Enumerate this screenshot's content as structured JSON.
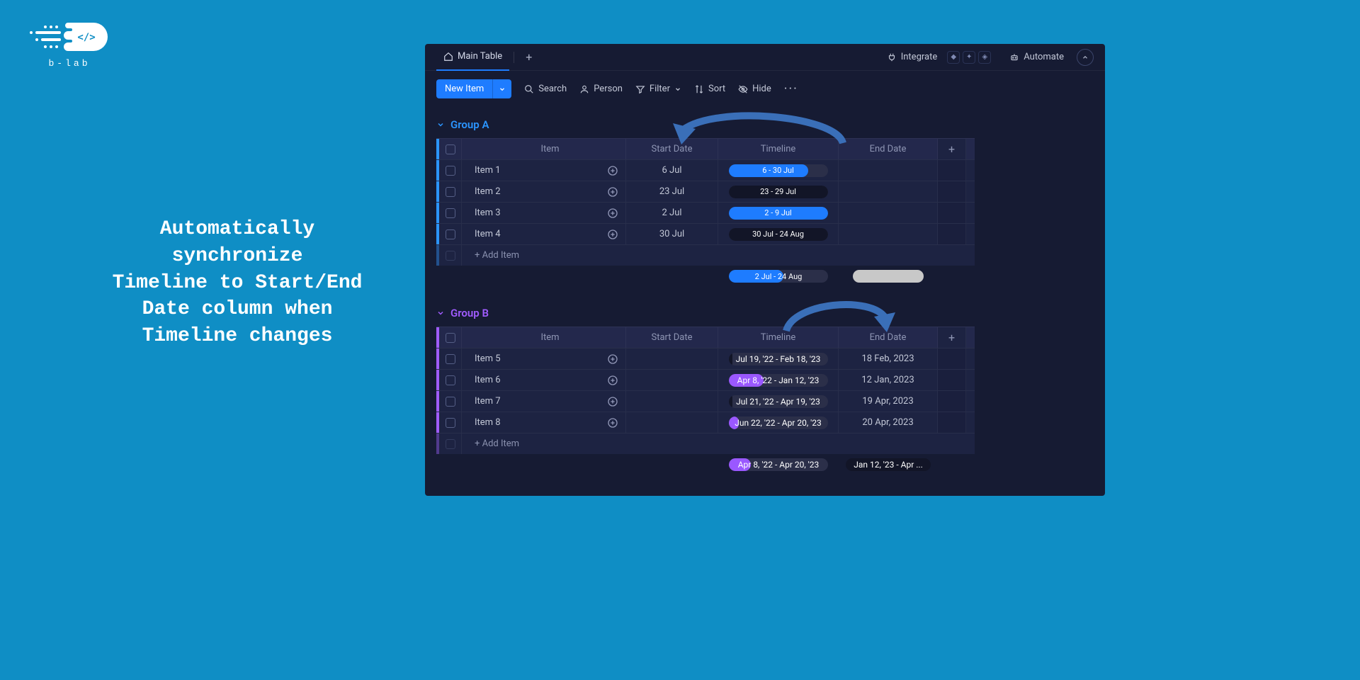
{
  "logo": {
    "text": "b-lab"
  },
  "headline": {
    "line1": "Automatically",
    "line2": "synchronize",
    "line3": "Timeline to Start/End",
    "line4": "Date column when",
    "line5": "Timeline changes"
  },
  "topbar": {
    "main_table": "Main Table",
    "integrate": "Integrate",
    "automate": "Automate"
  },
  "toolbar": {
    "new_item": "New Item",
    "search": "Search",
    "person": "Person",
    "filter": "Filter",
    "sort": "Sort",
    "hide": "Hide"
  },
  "columns": {
    "item": "Item",
    "start_date": "Start Date",
    "timeline": "Timeline",
    "end_date": "End Date"
  },
  "add_item": "+ Add Item",
  "group_a": {
    "title": "Group A",
    "rows": [
      {
        "item": "Item 1",
        "start": "6 Jul",
        "timeline": "6 - 30 Jul",
        "end": "",
        "fill": "blue",
        "fill_left": 0,
        "fill_width": 80
      },
      {
        "item": "Item 2",
        "start": "23 Jul",
        "timeline": "23 - 29 Jul",
        "end": "",
        "fill": "dark",
        "fill_left": 0,
        "fill_width": 100
      },
      {
        "item": "Item 3",
        "start": "2 Jul",
        "timeline": "2 - 9 Jul",
        "end": "",
        "fill": "blue",
        "fill_left": 0,
        "fill_width": 100
      },
      {
        "item": "Item 4",
        "start": "30 Jul",
        "timeline": "30 Jul - 24 Aug",
        "end": "",
        "fill": "dark",
        "fill_left": 0,
        "fill_width": 100
      }
    ],
    "summary_timeline": "2 Jul - 24 Aug",
    "summary_end": "-"
  },
  "group_b": {
    "title": "Group B",
    "rows": [
      {
        "item": "Item 5",
        "start": "",
        "timeline": "Jul 19, '22 - Feb 18, '23",
        "end": "18 Feb, 2023",
        "fill": "dark",
        "fill_left": 0,
        "fill_width": 4
      },
      {
        "item": "Item 6",
        "start": "",
        "timeline": "Apr 8, '22 - Jan 12, '23",
        "end": "12 Jan, 2023",
        "fill": "purple",
        "fill_left": 0,
        "fill_width": 35
      },
      {
        "item": "Item 7",
        "start": "",
        "timeline": "Jul 21, '22 - Apr 19, '23",
        "end": "19 Apr, 2023",
        "fill": "dark",
        "fill_left": 0,
        "fill_width": 4
      },
      {
        "item": "Item 8",
        "start": "",
        "timeline": "Jun 22, '22 - Apr 20, '23",
        "end": "20 Apr, 2023",
        "fill": "purple",
        "fill_left": 0,
        "fill_width": 10
      }
    ],
    "summary_timeline": "Apr 8, '22 - Apr 20, '23",
    "summary_end": "Jan 12, '23 - Apr ..."
  }
}
